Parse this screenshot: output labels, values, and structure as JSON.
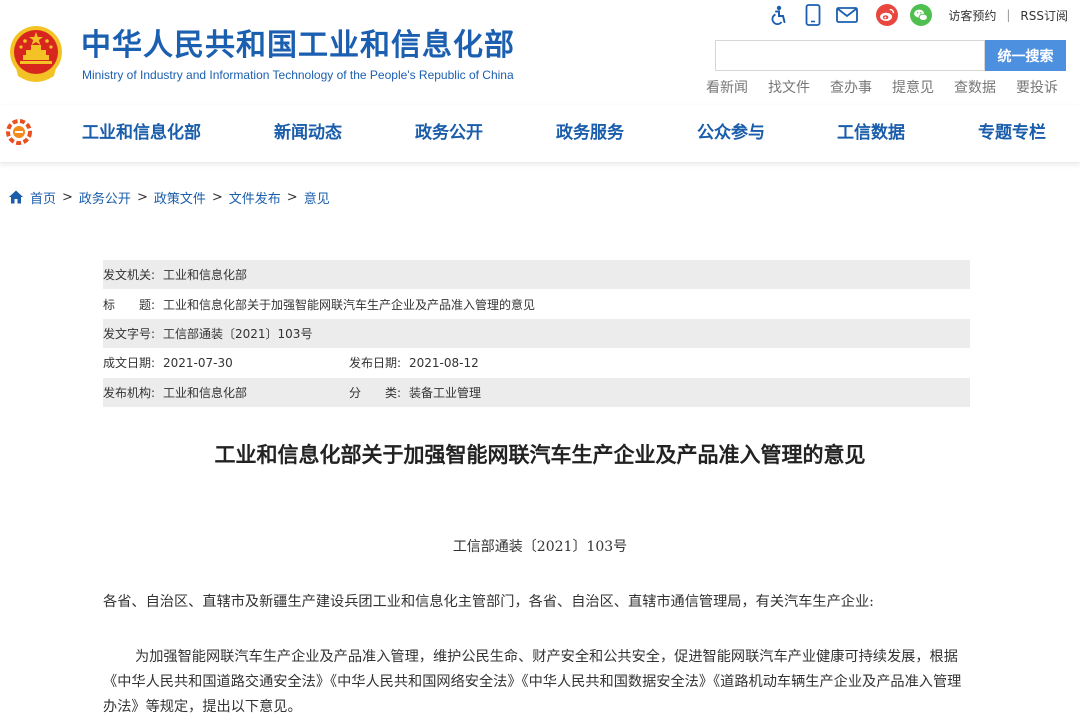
{
  "header": {
    "site_title": "中华人民共和国工业和信息化部",
    "site_subtitle": "Ministry of Industry and Information Technology of the People's Republic of China",
    "top_links": {
      "visitor_booking": "访客预约",
      "separator": "|",
      "rss": "RSS订阅"
    },
    "tool_icons": [
      "accessibility-icon",
      "mobile-icon",
      "mail-icon",
      "weibo-icon",
      "wechat-icon"
    ],
    "search": {
      "value": "",
      "placeholder": "",
      "button_label": "统一搜索"
    },
    "quick_links": [
      "看新闻",
      "找文件",
      "查办事",
      "提意见",
      "查数据",
      "要投诉"
    ]
  },
  "nav": {
    "items": [
      "工业和信息化部",
      "新闻动态",
      "政务公开",
      "政务服务",
      "公众参与",
      "工信数据",
      "专题专栏"
    ]
  },
  "breadcrumb": {
    "items": [
      "首页",
      "政务公开",
      "政策文件",
      "文件发布",
      "意见"
    ],
    "separator": ">"
  },
  "meta": {
    "issuer_label": "发文机关:",
    "issuer": "工业和信息化部",
    "title_label": "标　　题:",
    "title": "工业和信息化部关于加强智能网联汽车生产企业及产品准入管理的意见",
    "doc_no_label": "发文字号:",
    "doc_no": "工信部通装〔2021〕103号",
    "written_date_label": "成文日期:",
    "written_date": "2021-07-30",
    "publish_date_label": "发布日期:",
    "publish_date": "2021-08-12",
    "publisher_label": "发布机构:",
    "publisher": "工业和信息化部",
    "category_label": "分　　类:",
    "category": "装备工业管理"
  },
  "article": {
    "title": "工业和信息化部关于加强智能网联汽车生产企业及产品准入管理的意见",
    "doc_number": "工信部通装〔2021〕103号",
    "addressee": "各省、自治区、直辖市及新疆生产建设兵团工业和信息化主管部门，各省、自治区、直辖市通信管理局，有关汽车生产企业:",
    "paragraph_1": "为加强智能网联汽车生产企业及产品准入管理，维护公民生命、财产安全和公共安全，促进智能网联汽车产业健康可持续发展，根据《中华人民共和国道路交通安全法》《中华人民共和国网络安全法》《中华人民共和国数据安全法》《道路机动车辆生产企业及产品准入管理办法》等规定，提出以下意见。"
  },
  "colors": {
    "brand_blue": "#1b5fb0",
    "nav_blue": "#1a5dab",
    "search_button": "#4d90e0",
    "meta_shade": "#ececec",
    "emblem_red": "#d7261e",
    "emblem_gold": "#f3c326"
  }
}
